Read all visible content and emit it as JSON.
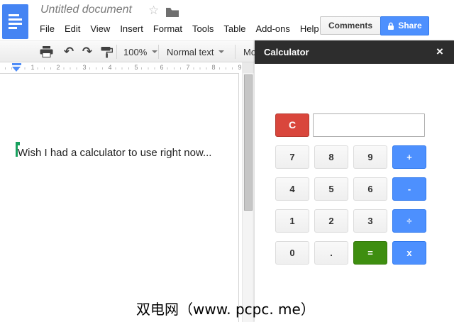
{
  "header": {
    "doc_title": "Untitled document",
    "star_icon": "☆",
    "menu": [
      "File",
      "Edit",
      "View",
      "Insert",
      "Format",
      "Tools",
      "Table",
      "Add-ons",
      "Help"
    ],
    "comments_button": "Comments",
    "share_button": "Share"
  },
  "toolbar": {
    "undo_icon": "↶",
    "redo_icon": "↷",
    "zoom_select": "100%",
    "styles_select": "Normal text",
    "truncated_item": "Mo"
  },
  "ruler": {
    "marks": [
      "1",
      "2",
      "3",
      "4",
      "5",
      "6",
      "7",
      "8",
      "9"
    ]
  },
  "document": {
    "text": "Wish I had a calculator to use right now..."
  },
  "calculator": {
    "title": "Calculator",
    "close_icon": "×",
    "clear_button": "C",
    "display_value": "",
    "keys": [
      "7",
      "8",
      "9",
      "+",
      "4",
      "5",
      "6",
      "-",
      "1",
      "2",
      "3",
      "÷",
      "0",
      ".",
      "=",
      "x"
    ]
  },
  "watermark": "双电网（www. pcpc. me）",
  "colors": {
    "brand_blue": "#4584f3",
    "accent_blue": "#4d90fe",
    "danger_red": "#d9463c",
    "success_green": "#3e8e10",
    "panel_header_dark": "#2d2d2d",
    "collab_cursor_green": "#19a15f"
  }
}
